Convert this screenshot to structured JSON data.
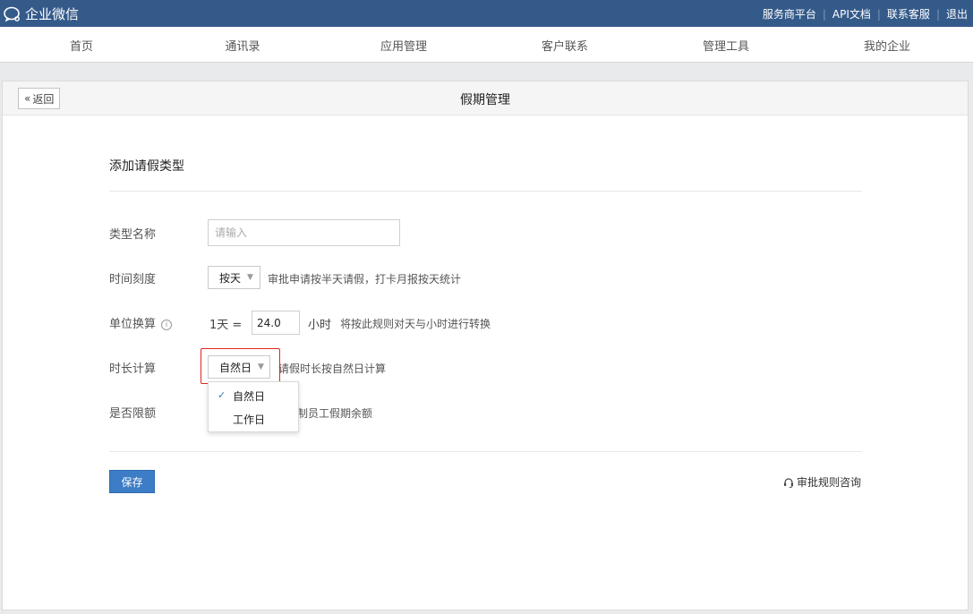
{
  "topbar": {
    "brand": "企业微信",
    "links": [
      "服务商平台",
      "API文档",
      "联系客服",
      "退出"
    ]
  },
  "nav": {
    "items": [
      "首页",
      "通讯录",
      "应用管理",
      "客户联系",
      "管理工具",
      "我的企业"
    ]
  },
  "panel": {
    "back_label": "返回",
    "title": "假期管理"
  },
  "form": {
    "section_title": "添加请假类型",
    "name": {
      "label": "类型名称",
      "placeholder": "请输入",
      "value": ""
    },
    "granularity": {
      "label": "时间刻度",
      "selected": "按天",
      "hint": "审批申请按半天请假，打卡月报按天统计"
    },
    "conversion": {
      "label": "单位换算",
      "prefix": "1天 =",
      "value": "24.0",
      "unit": "小时",
      "hint": "将按此规则对天与小时进行转换"
    },
    "duration": {
      "label": "时长计算",
      "selected": "自然日",
      "hint": "请假时长按自然日计算",
      "options": [
        {
          "label": "自然日",
          "checked": true
        },
        {
          "label": "工作日",
          "checked": false
        }
      ]
    },
    "limit": {
      "label": "是否限额",
      "hint": "制员工假期余额"
    }
  },
  "footer": {
    "save_label": "保存",
    "consult_label": "审批规则咨询"
  },
  "colors": {
    "topbar": "#345a8a",
    "primary_button": "#3d7cc6",
    "highlight_border": "#e0271e"
  }
}
